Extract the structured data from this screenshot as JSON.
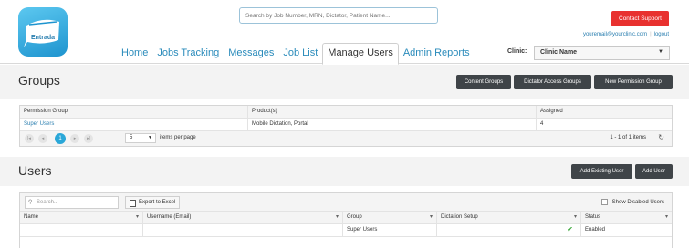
{
  "logo": {
    "text": "Entrada"
  },
  "search": {
    "placeholder": "Search by Job Number, MRN, Dictator, Patient Name..."
  },
  "contact_support": "Contact Support",
  "user": {
    "email": "youremail@yourclinic.com",
    "logout": "logout"
  },
  "nav": {
    "tabs": [
      "Home",
      "Jobs Tracking",
      "Messages",
      "Job List",
      "Manage Users",
      "Admin Reports"
    ],
    "active": "Manage Users"
  },
  "clinic": {
    "label": "Clinic:",
    "value": "Clinic Name"
  },
  "groups": {
    "title": "Groups",
    "buttons": [
      "Content Groups",
      "Dictator Access Groups",
      "New Permission Group"
    ],
    "columns": [
      "Permission Group",
      "Product(s)",
      "Assigned"
    ],
    "rows": [
      {
        "group": "Super Users",
        "products": "Mobile Dictation, Portal",
        "assigned": "4"
      }
    ],
    "pager": {
      "current_page": "1",
      "page_size": "5",
      "per_page_label": "items per page",
      "info": "1 - 1 of 1 items"
    }
  },
  "users": {
    "title": "Users",
    "buttons": [
      "Add Existing User",
      "Add User"
    ],
    "search_placeholder": "Search..",
    "export_label": "Export to Excel",
    "show_disabled_label": "Show Disabled Users",
    "columns": [
      "Name",
      "Username (Email)",
      "Group",
      "Dictation Setup",
      "Status"
    ],
    "rows": [
      {
        "name": "",
        "username": "",
        "group": "Super Users",
        "dictation_setup": "check",
        "status": "Enabled"
      }
    ]
  },
  "colors": {
    "accent": "#2a8bbb",
    "contact_red": "#e8312f",
    "dark_button": "#3f4448",
    "pager_active": "#2aa7d8"
  }
}
